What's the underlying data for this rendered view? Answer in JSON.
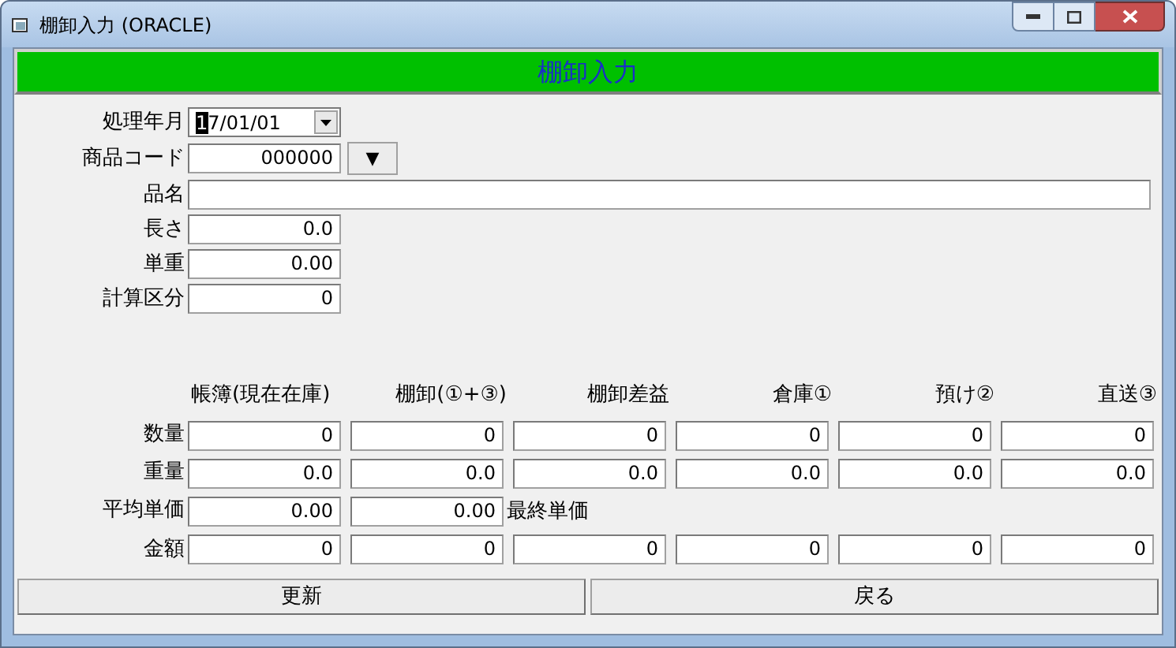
{
  "window": {
    "title": "棚卸入力 (ORACLE)"
  },
  "header": {
    "title": "棚卸入力"
  },
  "fields": [
    {
      "label": "処理年月",
      "value": "17/01/01",
      "kind": "date",
      "focused": true
    },
    {
      "label": "商品コード",
      "value": "000000",
      "kind": "code",
      "button": "▼"
    },
    {
      "label": "品名",
      "kind": "wide"
    },
    {
      "label": "長さ",
      "value": "0.0",
      "kind": "number"
    },
    {
      "label": "単重",
      "value": "0.00",
      "kind": "number"
    },
    {
      "label": "計算区分",
      "value": "0",
      "kind": "number"
    }
  ],
  "table": {
    "columns": [
      "帳簿(現在在庫)",
      "棚卸(①+③)",
      "棚卸差益",
      "倉庫①",
      "預け②",
      "直送③"
    ],
    "rows": [
      {
        "label": "数量",
        "cells": [
          "0",
          "0",
          "0",
          "0",
          "0",
          "0"
        ]
      },
      {
        "label": "重量",
        "cells": [
          "0.0",
          "0.0",
          "0.0",
          "0.0",
          "0.0",
          "0.0"
        ]
      },
      {
        "label": "平均単価",
        "cells": [
          "0.00",
          "0.00"
        ],
        "note": "最終単価"
      },
      {
        "label": "金額",
        "cells": [
          "0",
          "0",
          "0",
          "0",
          "0",
          "0"
        ]
      }
    ]
  },
  "buttons": [
    "更新",
    "戻る"
  ]
}
